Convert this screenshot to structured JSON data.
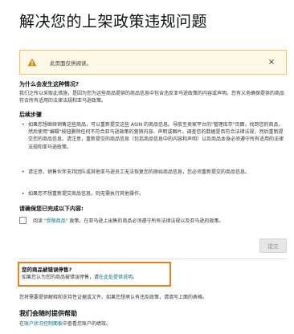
{
  "page": {
    "title": "解决您的上架政策违规问题"
  },
  "alert": {
    "icon": "warning-icon",
    "message": "此页面仅供阅读。",
    "close_label": "×",
    "accent": "#f0c36d"
  },
  "why": {
    "heading": "为什么会发生这种情况?",
    "body": "我们之所以采取此措施，是因为您为这些商品提供的商品信息中包含违反亚马逊政策的内容或声明。您有义务确保提供的商品符合所有适用的法律法规和亚马逊政策。"
  },
  "next_steps": {
    "heading": "后续步骤",
    "bullets": [
      "如果您想继续销售这些商品，可以重新提交这些 ASIN 的商品信息。导航至卖家平台的\"管理库存\"页面，找到您的商品，然后使用\"编辑\"按钮删除任何不符合亚马逊政策的营销内容、声明或图片。调查您的数据是否符合法律法规，然后重新提交您的商品信息。请注意，重新提交的商品信息（包括商品信息中的内容和声明）以及商品本身必须遵守所有适用的法律法规和亚马逊政策。",
      "请注意，销售伙伴支持团队或其他亚马逊员工无法恢复您的原始商品信息，您必须重新提交的商品信息。",
      "如果您不想重新提交商品信息，则无需执行其他操作。"
    ]
  },
  "confirm": {
    "heading": "请确保您已完成以下内容:",
    "checkbox_prefix": "阅读",
    "checkbox_link": "\"受限商品\"",
    "checkbox_suffix": "政策。在亚马逊上出售的商品必须遵守所有法律法规以及亚马逊的政策。",
    "checked": false
  },
  "submit": {
    "label": "提交",
    "enabled": false
  },
  "mistake": {
    "heading": "您的商品被错误停售?",
    "text_prefix": "如果您认为您的商品被错误停售，请",
    "link": "在此处提供说明",
    "text_suffix": "。",
    "highlight_color": "#f07f1a"
  },
  "note": {
    "text": "您将需要提供解释和支持性证据或文件。如果您想承认有违反政策，请填写上面的表格。"
  },
  "help": {
    "heading": "我们会随时提供帮助",
    "prefix": "在",
    "link": "账户状况控制面板",
    "suffix": "中查看您账户的绩效。"
  }
}
